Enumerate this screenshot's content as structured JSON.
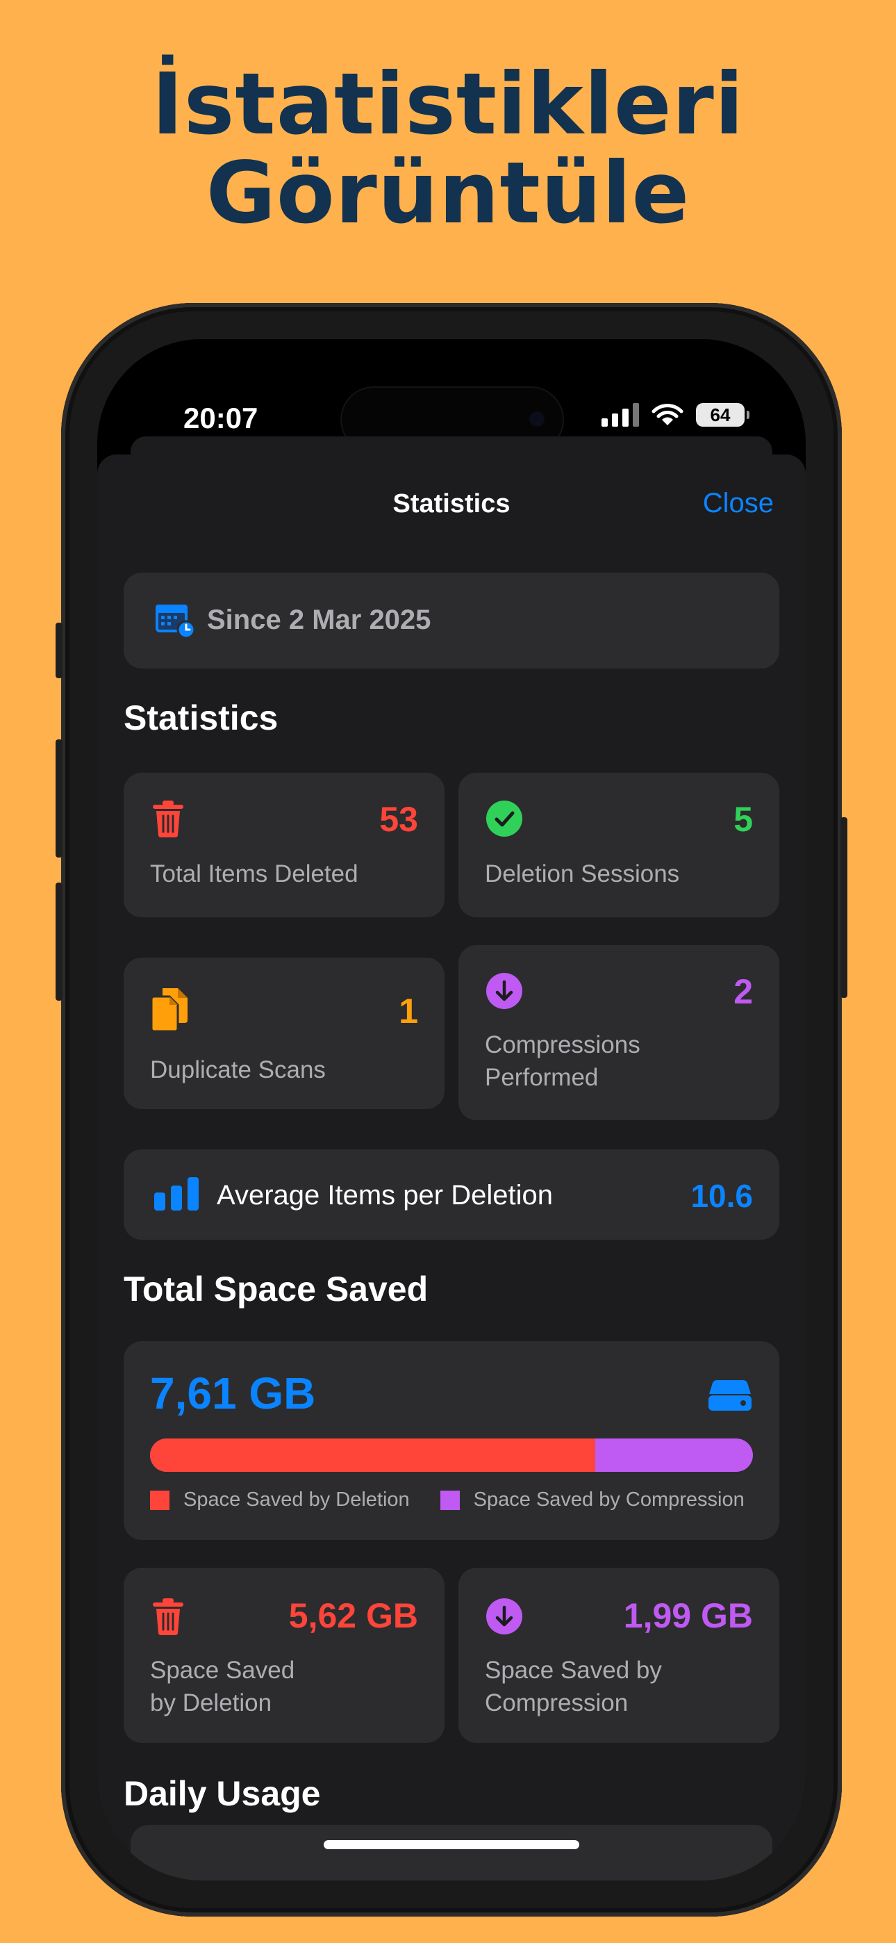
{
  "promo": {
    "title_line1": "İstatistikleri",
    "title_line2": "Görüntüle"
  },
  "status_bar": {
    "time": "20:07",
    "battery": "64"
  },
  "nav": {
    "title": "Statistics",
    "close_label": "Close"
  },
  "since": {
    "label": "Since 2 Mar 2025"
  },
  "statistics": {
    "heading": "Statistics",
    "cards": [
      {
        "label": "Total Items Deleted",
        "value": "53",
        "color": "#FF453A",
        "icon": "trash-icon"
      },
      {
        "label": "Deletion Sessions",
        "value": "5",
        "color": "#30D158",
        "icon": "checkmark-circle-icon"
      },
      {
        "label": "Duplicate Scans",
        "value": "1",
        "color": "#FF9F0A",
        "icon": "duplicate-docs-icon"
      },
      {
        "label_line1": "Compressions",
        "label_line2": "Performed",
        "value": "2",
        "color": "#BF5AF2",
        "icon": "arrow-down-circle-icon"
      }
    ],
    "average": {
      "label": "Average Items per Deletion",
      "value": "10.6",
      "icon": "bar-chart-icon"
    }
  },
  "space_saved": {
    "heading": "Total Space Saved",
    "total": "7,61 GB",
    "deletion_fraction": 0.739,
    "legend_deletion": "Space Saved by Deletion",
    "legend_compression": "Space Saved by Compression",
    "deletion_card": {
      "value": "5,62 GB",
      "label_line1": "Space Saved",
      "label_line2": "by Deletion",
      "color": "#FF453A"
    },
    "compression_card": {
      "value": "1,99 GB",
      "label_line1": "Space Saved by",
      "label_line2": "Compression",
      "color": "#BF5AF2"
    }
  },
  "daily": {
    "heading": "Daily Usage"
  },
  "colors": {
    "accent": "#0A84FF",
    "red": "#FF453A",
    "green": "#30D158",
    "orange": "#FF9F0A",
    "purple": "#BF5AF2"
  }
}
